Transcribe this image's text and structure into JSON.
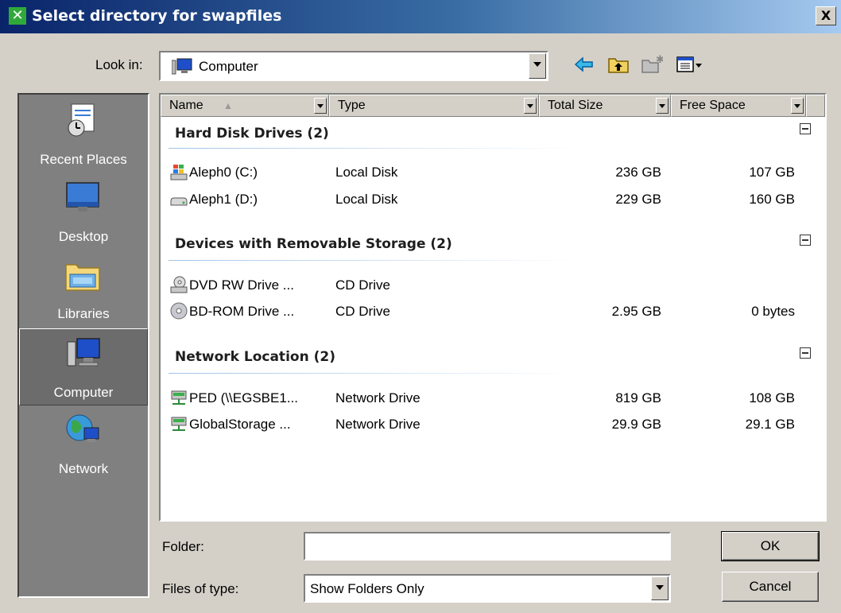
{
  "window": {
    "title": "Select directory for swapfiles",
    "close_glyph": "X"
  },
  "toolbar": {
    "look_in_label": "Look in:",
    "look_in_value": "Computer",
    "icons": [
      "back-arrow-icon",
      "up-folder-icon",
      "new-folder-icon",
      "view-menu-icon"
    ]
  },
  "places": [
    {
      "label": "Recent Places",
      "icon": "recent-places-icon"
    },
    {
      "label": "Desktop",
      "icon": "desktop-icon"
    },
    {
      "label": "Libraries",
      "icon": "libraries-icon"
    },
    {
      "label": "Computer",
      "icon": "computer-icon",
      "selected": true
    },
    {
      "label": "Network",
      "icon": "network-icon"
    }
  ],
  "columns": [
    "Name",
    "Type",
    "Total Size",
    "Free Space"
  ],
  "groups": [
    {
      "title": "Hard Disk Drives (2)",
      "items": [
        {
          "name": "Aleph0 (C:)",
          "type": "Local Disk",
          "total": "236 GB",
          "free": "107 GB",
          "icon": "system-drive-icon"
        },
        {
          "name": "Aleph1 (D:)",
          "type": "Local Disk",
          "total": "229 GB",
          "free": "160 GB",
          "icon": "hard-drive-icon"
        }
      ]
    },
    {
      "title": "Devices with Removable Storage (2)",
      "items": [
        {
          "name": "DVD RW Drive ...",
          "type": "CD Drive",
          "total": "",
          "free": "",
          "icon": "dvd-drive-icon"
        },
        {
          "name": "BD-ROM Drive ...",
          "type": "CD Drive",
          "total": "2.95 GB",
          "free": "0 bytes",
          "icon": "disc-icon"
        }
      ]
    },
    {
      "title": "Network Location (2)",
      "items": [
        {
          "name": "PED (\\\\EGSBE1...",
          "type": "Network Drive",
          "total": "819 GB",
          "free": "108 GB",
          "icon": "network-drive-icon"
        },
        {
          "name": "GlobalStorage ...",
          "type": "Network Drive",
          "total": "29.9 GB",
          "free": "29.1 GB",
          "icon": "network-drive-icon"
        }
      ]
    }
  ],
  "folder": {
    "label": "Folder:",
    "value": ""
  },
  "filetype": {
    "label": "Files of type:",
    "value": "Show Folders Only"
  },
  "buttons": {
    "ok": "OK",
    "cancel": "Cancel"
  },
  "colors": {
    "title_start": "#0a246a",
    "title_end": "#a6caf0",
    "face": "#d4d0c8",
    "places_bg": "#808080"
  }
}
